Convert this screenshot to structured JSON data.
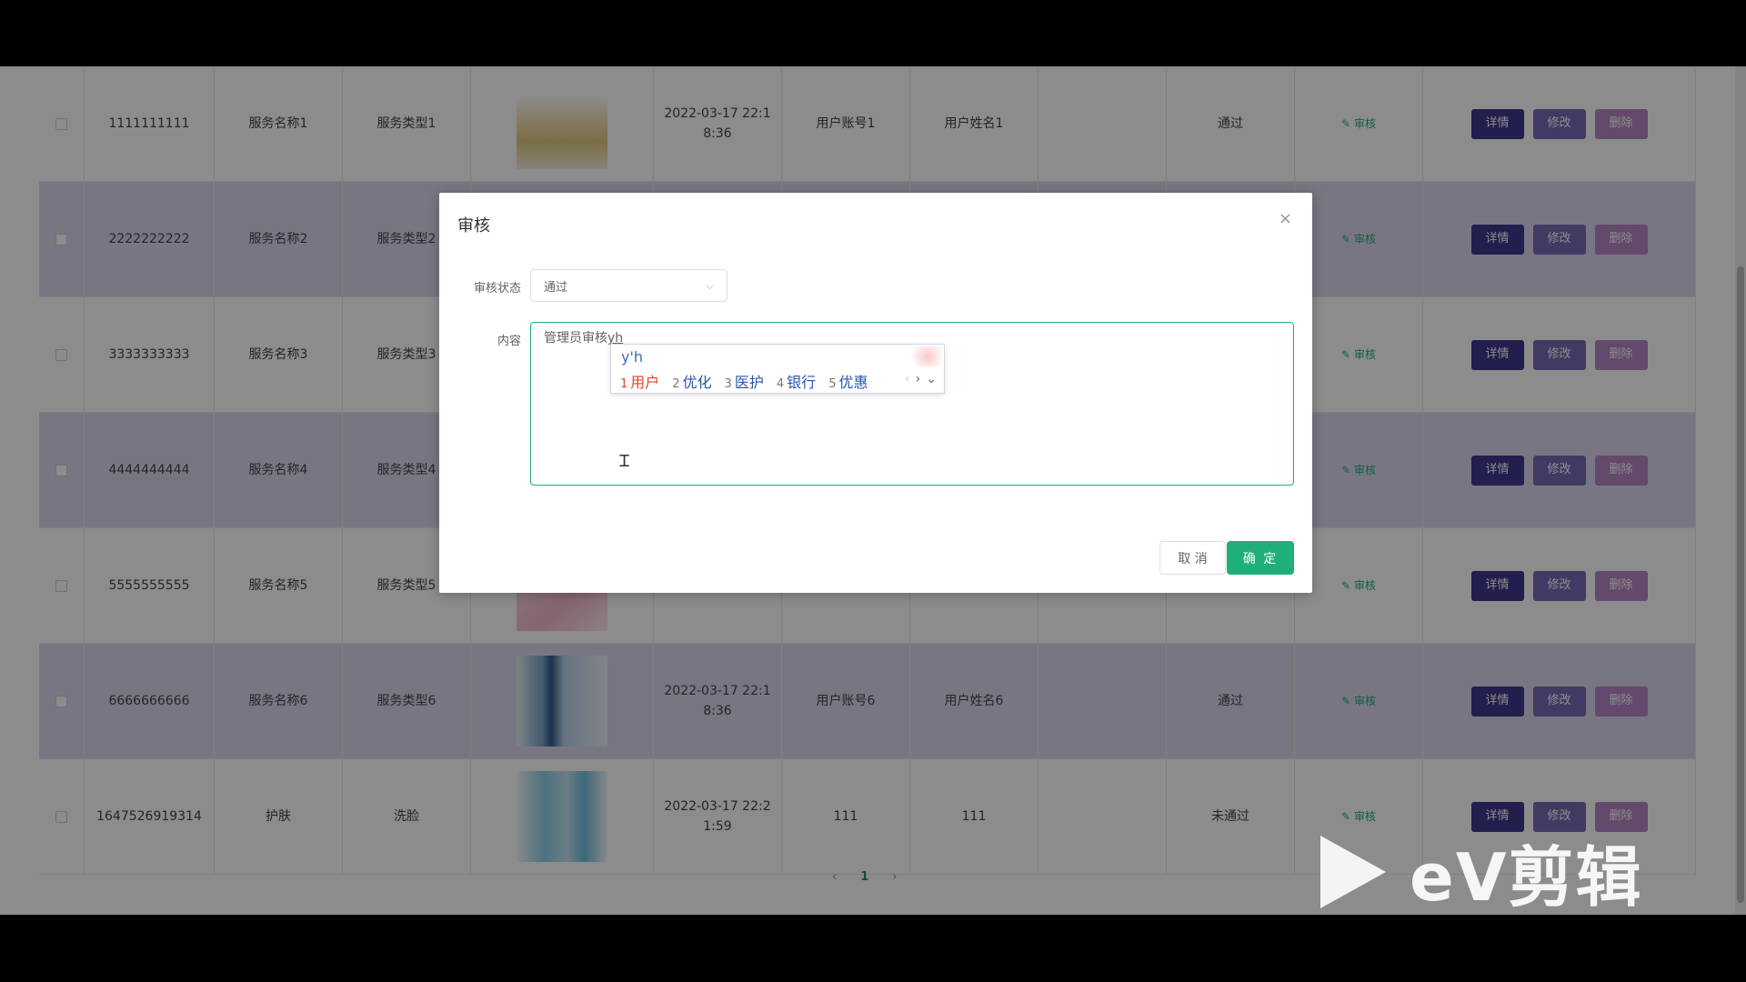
{
  "table": {
    "rows": [
      {
        "id": "1111111111",
        "name": "服务名称1",
        "type": "服务类型1",
        "time": "2022-03-17 22:1\n8:36",
        "account": "用户账号1",
        "username": "用户姓名1",
        "remark": "",
        "result": "通过",
        "thumb": "t-perfume"
      },
      {
        "id": "2222222222",
        "name": "服务名称2",
        "type": "服务类型2",
        "time": "",
        "account": "",
        "username": "",
        "remark": "",
        "result": "",
        "thumb": "t-blue"
      },
      {
        "id": "3333333333",
        "name": "服务名称3",
        "type": "服务类型3",
        "time": "",
        "account": "",
        "username": "",
        "remark": "",
        "result": "",
        "thumb": ""
      },
      {
        "id": "4444444444",
        "name": "服务名称4",
        "type": "服务类型4",
        "time": "",
        "account": "",
        "username": "",
        "remark": "",
        "result": "",
        "thumb": ""
      },
      {
        "id": "5555555555",
        "name": "服务名称5",
        "type": "服务类型5",
        "time": "",
        "account": "",
        "username": "",
        "remark": "",
        "result": "",
        "thumb": "t-pink"
      },
      {
        "id": "6666666666",
        "name": "服务名称6",
        "type": "服务类型6",
        "time": "2022-03-17 22:1\n8:36",
        "account": "用户账号6",
        "username": "用户姓名6",
        "remark": "",
        "result": "通过",
        "thumb": "t-serum"
      },
      {
        "id": "1647526919314",
        "name": "护肤",
        "type": "洗脸",
        "time": "2022-03-17 22:2\n1:59",
        "account": "111",
        "username": "111",
        "remark": "",
        "result": "未通过",
        "thumb": "t-cream"
      }
    ],
    "review_link": "审核",
    "detail_btn": "详情",
    "edit_btn": "修改",
    "delete_btn": "删除"
  },
  "pager": {
    "prev": "‹",
    "current": "1",
    "next": "›"
  },
  "modal": {
    "title": "审核",
    "close": "×",
    "status_label": "审核状态",
    "status_value": "通过",
    "content_label": "内容",
    "content_text": "管理员审核",
    "typed_pinyin": "yh",
    "cancel": "取 消",
    "confirm": "确 定"
  },
  "ime": {
    "input": "y'h",
    "candidates": [
      {
        "n": "1",
        "word": "用户"
      },
      {
        "n": "2",
        "word": "优化"
      },
      {
        "n": "3",
        "word": "医护"
      },
      {
        "n": "4",
        "word": "银行"
      },
      {
        "n": "5",
        "word": "优惠"
      }
    ]
  },
  "watermark": {
    "text": "eV剪辑"
  }
}
